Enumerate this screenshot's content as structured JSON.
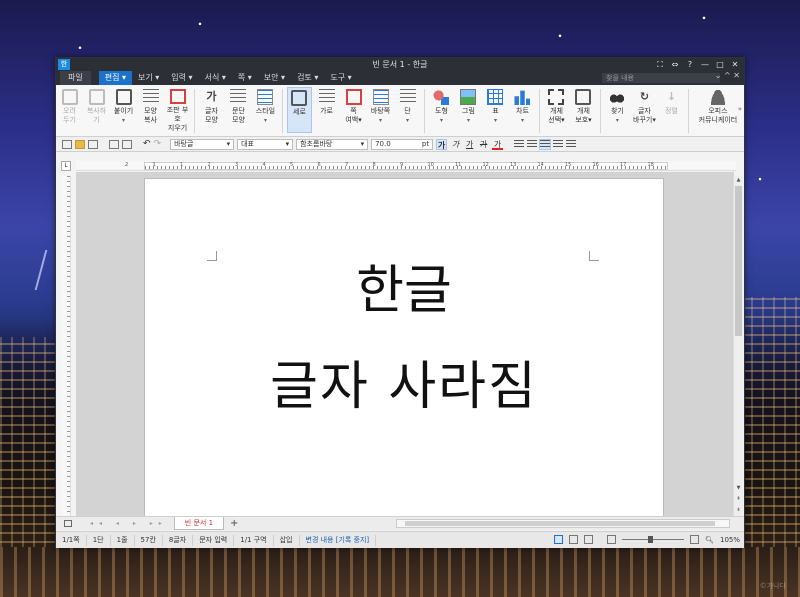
{
  "window": {
    "title": "빈 문서 1 - 한글",
    "app_icon_text": "한"
  },
  "titlebar_controls": [
    "⛶",
    "⇔",
    "?",
    "—",
    "□",
    "✕"
  ],
  "menus": {
    "file": "파일",
    "items": [
      "편집 ▾",
      "보기 ▾",
      "입력 ▾",
      "서식 ▾",
      "쪽 ▾",
      "보안 ▾",
      "검토 ▾",
      "도구 ▾"
    ],
    "search_placeholder": "찾을 내용",
    "right": "⌄ ^ ✕"
  },
  "ribbon": [
    {
      "l1": "오려",
      "l2": "두기"
    },
    {
      "l1": "복사하기",
      "l2": ""
    },
    {
      "l1": "붙이기",
      "l2": "▾"
    },
    {
      "l1": "모양",
      "l2": "복사"
    },
    {
      "l1": "조판 부호",
      "l2": "지우기"
    },
    {
      "l1": "글자",
      "l2": "모양"
    },
    {
      "l1": "문단",
      "l2": "모양"
    },
    {
      "l1": "스타일",
      "l2": "▾"
    },
    {
      "l1": "세로",
      "l2": ""
    },
    {
      "l1": "가로",
      "l2": ""
    },
    {
      "l1": "쪽",
      "l2": "여백▾"
    },
    {
      "l1": "바탕쪽",
      "l2": "▾"
    },
    {
      "l1": "단",
      "l2": "▾"
    },
    {
      "l1": "도형",
      "l2": "▾"
    },
    {
      "l1": "그림",
      "l2": "▾"
    },
    {
      "l1": "표",
      "l2": "▾"
    },
    {
      "l1": "차트",
      "l2": "▾"
    },
    {
      "l1": "개체",
      "l2": "선택▾"
    },
    {
      "l1": "개체",
      "l2": "보호▾"
    },
    {
      "l1": "찾기",
      "l2": "▾"
    },
    {
      "l1": "글자",
      "l2": "바꾸기▾"
    },
    {
      "l1": "정렬",
      "l2": ""
    },
    {
      "l1": "오피스",
      "l2": "커뮤니케이터"
    }
  ],
  "format_bar": {
    "style": "바탕글",
    "lang": "대표",
    "font": "함초롬바탕",
    "size": "70.0",
    "unit": "pt",
    "bold_glyph": "가",
    "italic_glyph": "가",
    "underline_glyph": "가",
    "strike_glyph": "가",
    "color_glyph": "가"
  },
  "ruler_numbers": [
    "2",
    "1",
    "1",
    "2",
    "3",
    "4",
    "5",
    "6",
    "7",
    "8",
    "9",
    "10",
    "11",
    "12",
    "13",
    "14",
    "15",
    "16",
    "17",
    "18"
  ],
  "document": {
    "line1": "한글",
    "line2": "글자 사라짐"
  },
  "tab": {
    "name": "빈 문서 1",
    "add": "+"
  },
  "status": {
    "page": "1/1쪽",
    "col": "1단",
    "line": "1줄",
    "pos": "57칸",
    "chars": "8글자",
    "mode": "문자 입력",
    "section": "1/1 구역",
    "insert": "삽입",
    "track": "변경 내용 [기록 중지]",
    "zoom": "105%"
  },
  "watermark": "©가나다"
}
